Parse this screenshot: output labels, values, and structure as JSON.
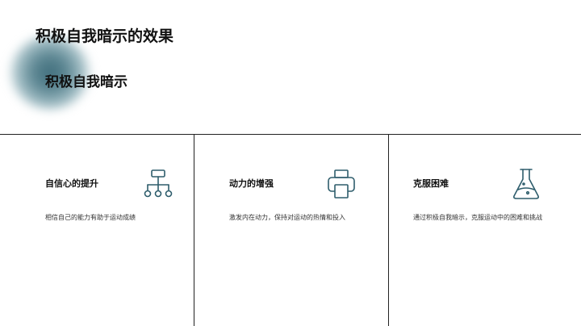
{
  "slide": {
    "title": "积极自我暗示的效果",
    "subtitle": "积极自我暗示"
  },
  "icon_color": "#2e5d6c",
  "cards": [
    {
      "title": "自信心的提升",
      "text": "相信自己的能力有助于运动成绩",
      "icon": "hierarchy-icon"
    },
    {
      "title": "动力的增强",
      "text": "激发内在动力，保持对运动的热情和投入",
      "icon": "printer-icon"
    },
    {
      "title": "克服困难",
      "text": "通过积极自我暗示，克服运动中的困难和挑战",
      "icon": "flask-icon"
    }
  ]
}
